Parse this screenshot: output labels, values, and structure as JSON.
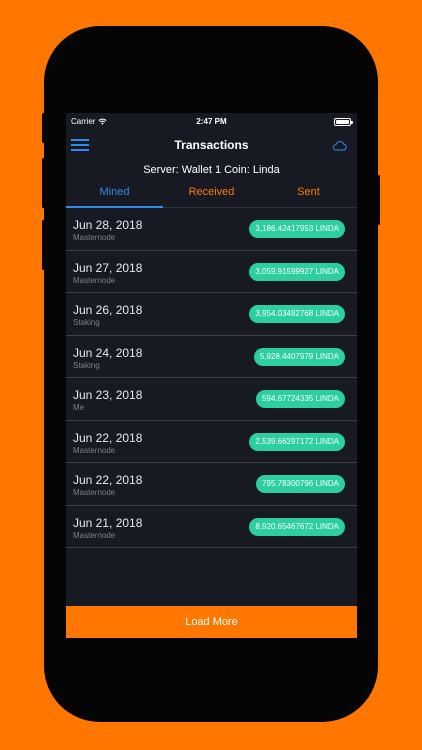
{
  "status_bar": {
    "carrier": "Carrier",
    "time": "2:47 PM"
  },
  "nav": {
    "title": "Transactions",
    "menu_icon": "hamburger-menu-icon",
    "cloud_icon": "cloud-icon"
  },
  "server_line": "Server: Wallet 1 Coin: Linda",
  "tabs": [
    {
      "label": "Mined",
      "active": true
    },
    {
      "label": "Received",
      "active": false
    },
    {
      "label": "Sent",
      "active": false
    }
  ],
  "transactions": [
    {
      "date": "Jun 28, 2018",
      "type": "Masternode",
      "amount": "3,186.42417953 LINDA"
    },
    {
      "date": "Jun 27, 2018",
      "type": "Masternode",
      "amount": "3,059.91599927 LINDA"
    },
    {
      "date": "Jun 26, 2018",
      "type": "Staking",
      "amount": "3,954.03482768 LINDA"
    },
    {
      "date": "Jun 24, 2018",
      "type": "Staking",
      "amount": "5,928.4407979 LINDA"
    },
    {
      "date": "Jun 23, 2018",
      "type": "Me",
      "amount": "594.67724335 LINDA"
    },
    {
      "date": "Jun 22, 2018",
      "type": "Masternode",
      "amount": "2,539.66297172 LINDA"
    },
    {
      "date": "Jun 22, 2018",
      "type": "Masternode",
      "amount": "795.78300796 LINDA"
    },
    {
      "date": "Jun 21, 2018",
      "type": "Masternode",
      "amount": "8,920.65467672 LINDA"
    }
  ],
  "load_more": "Load More",
  "colors": {
    "background": "#ff7700",
    "screen": "#171a22",
    "accent_blue": "#2f8ce8",
    "accent_orange": "#ff7a00",
    "amount_badge": "#2ccfa0"
  }
}
